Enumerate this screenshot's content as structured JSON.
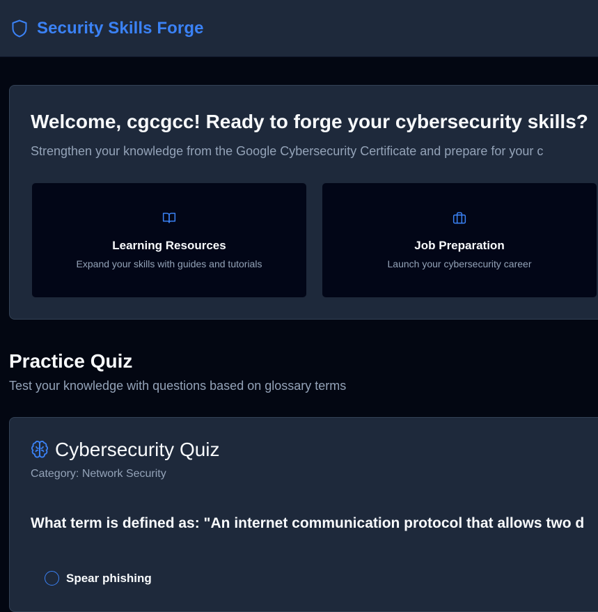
{
  "header": {
    "brand_title": "Security Skills Forge",
    "brand_icon": "shield-icon",
    "brand_color": "#3b82f6"
  },
  "welcome": {
    "title": "Welcome, cgcgcc! Ready to forge your cybersecurity skills?",
    "subtitle": "Strengthen your knowledge from the Google Cybersecurity Certificate and prepare for your c",
    "tiles": [
      {
        "icon": "book-open-icon",
        "title": "Learning Resources",
        "description": "Expand your skills with guides and tutorials"
      },
      {
        "icon": "briefcase-icon",
        "title": "Job Preparation",
        "description": "Launch your cybersecurity career"
      }
    ]
  },
  "practice": {
    "title": "Practice Quiz",
    "subtitle": "Test your knowledge with questions based on glossary terms"
  },
  "quiz": {
    "icon": "brain-icon",
    "title": "Cybersecurity Quiz",
    "category": "Category: Network Security",
    "question": "What term is defined as: \"An internet communication protocol that allows two d",
    "options": [
      {
        "label": "Spear phishing",
        "selected": false
      }
    ]
  },
  "colors": {
    "background": "#030712",
    "card": "#1e293b",
    "tile": "#020617",
    "accent": "#3b82f6",
    "muted_text": "#94a3b8"
  }
}
